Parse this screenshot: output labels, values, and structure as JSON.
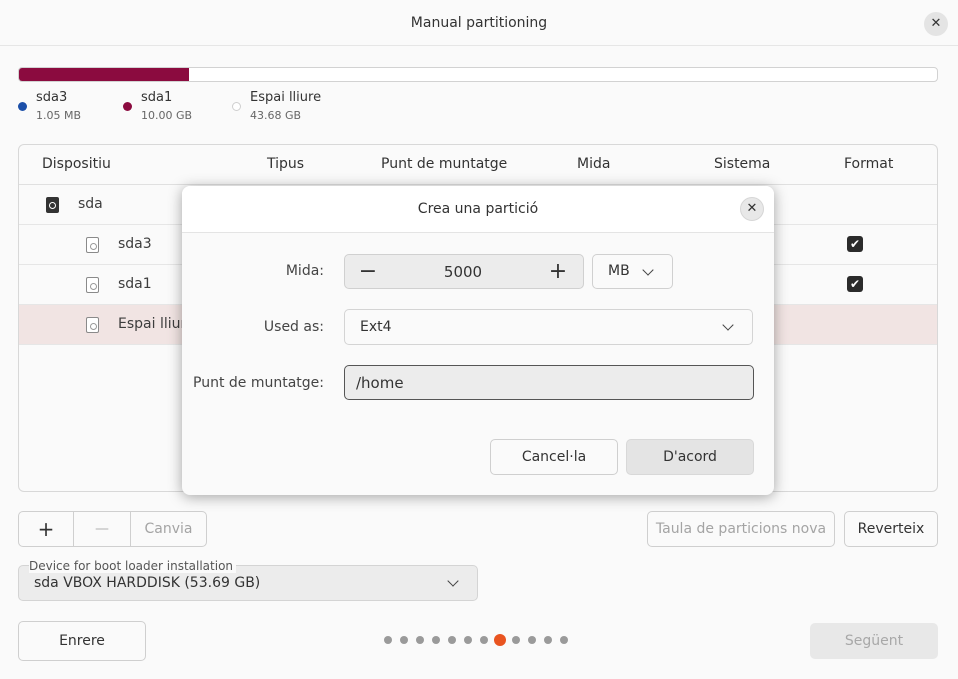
{
  "window": {
    "title": "Manual partitioning",
    "close_glyph": "✕"
  },
  "usage": {
    "fill_fraction": 0.185,
    "fill_color": "#8b0b3f",
    "legend": [
      {
        "name": "sda3",
        "size": "1.05 MB",
        "color": "#1b4fa8"
      },
      {
        "name": "sda1",
        "size": "10.00 GB",
        "color": "#8b0b3f"
      },
      {
        "name": "Espai lliure",
        "size": "43.68 GB",
        "color": "#ffffff"
      }
    ]
  },
  "table": {
    "headers": [
      "Dispositiu",
      "Tipus",
      "Punt de muntatge",
      "Mida",
      "Sistema",
      "Format"
    ],
    "rows": [
      {
        "device": "sda",
        "icon": "disk-icon",
        "format_checked": false
      },
      {
        "device": "sda3",
        "icon": "partition-icon",
        "format_checked": true
      },
      {
        "device": "sda1",
        "icon": "partition-icon",
        "format_checked": true
      },
      {
        "device": "Espai lliure",
        "icon": "partition-icon",
        "format_checked": false,
        "selected": true
      }
    ]
  },
  "toolbar": {
    "add_glyph": "+",
    "remove_glyph": "—",
    "change_label": "Canvia",
    "new_table_label": "Taula de particions nova",
    "revert_label": "Reverteix"
  },
  "boot": {
    "label": "Device for boot loader installation",
    "value": "sda VBOX HARDDISK (53.69 GB)"
  },
  "footer": {
    "back_label": "Enrere",
    "next_label": "Següent",
    "page_count": 12,
    "current_page": 8
  },
  "dialog": {
    "title": "Crea una partició",
    "close_glyph": "✕",
    "size_label": "Mida:",
    "size_value": "5000",
    "minus_glyph": "−",
    "plus_glyph": "+",
    "unit": "MB",
    "used_as_label": "Used as:",
    "used_as_value": "Ext4",
    "mount_label": "Punt de muntatge:",
    "mount_value": "/home",
    "cancel_label": "Cancel·la",
    "ok_label": "D'acord"
  },
  "colors": {
    "accent": "#e95420",
    "selected_row": "#f1e4e3"
  }
}
